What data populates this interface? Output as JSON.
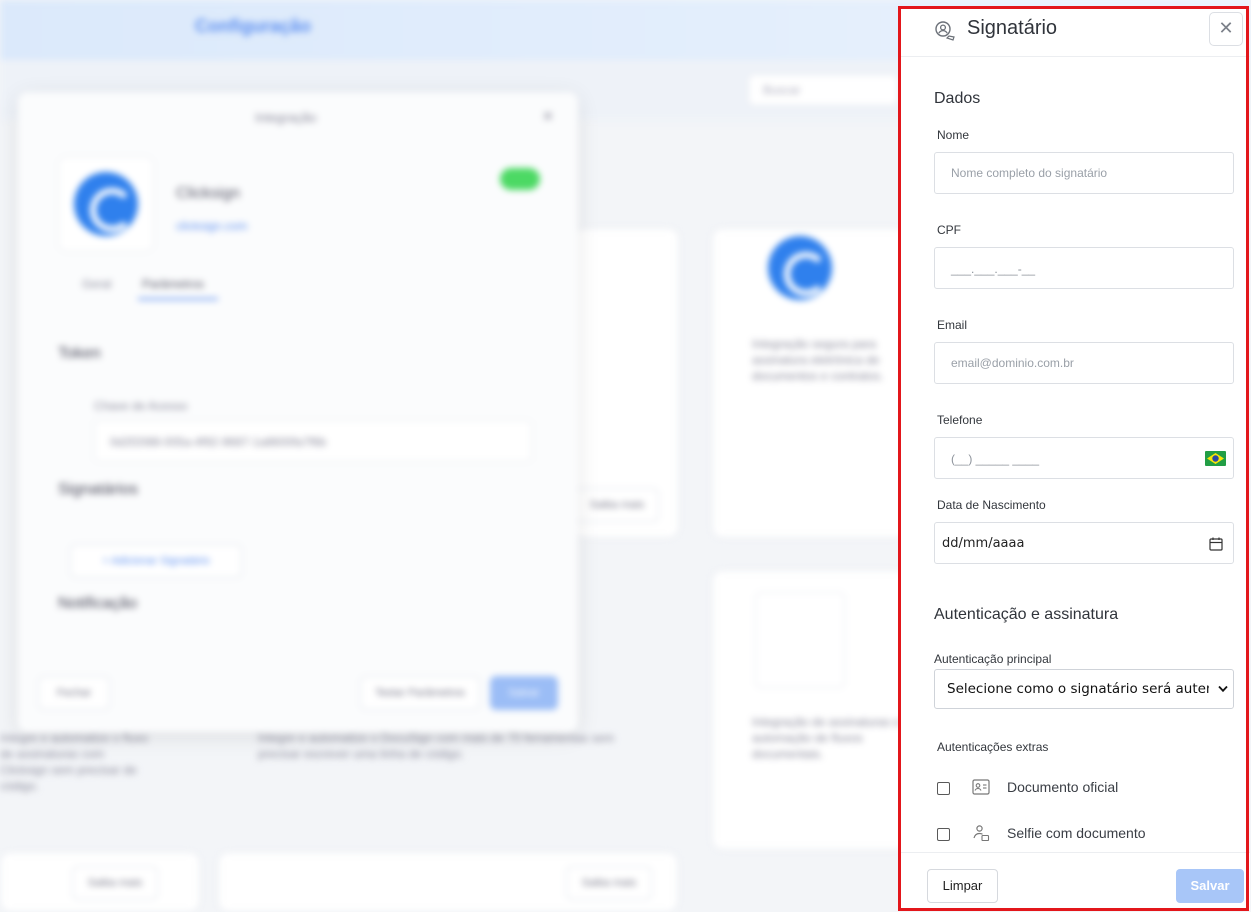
{
  "background": {
    "topbar_title": "Configuração",
    "search_placeholder": "Buscar",
    "modal": {
      "title": "Integração",
      "app_name": "Clicksign",
      "app_link": "clicksign.com",
      "tabs": [
        "Geral",
        "Parâmetros"
      ],
      "token_section": "Token",
      "token_label": "Chave de Acesso",
      "token_value": "0d2f2088-005a-4f92-9687-1a8600fa7f6b",
      "signatarios_section": "Signatários",
      "add_signatario": "+  Adicionar Signatário",
      "notificacao_section": "Notificação",
      "btn_fechar": "Fechar",
      "btn_testar": "Testar Parâmetros",
      "btn_salvar": "Salvar"
    },
    "card_more": "Saiba mais",
    "card_desc_1": "Integre e automatize o fluxo de assinaturas com Clicksign sem precisar de código.",
    "card_desc_2": "Integre e automatize o DocuSign com mais de 70 ferramentas sem precisar escrever uma linha de código."
  },
  "panel": {
    "title": "Signatário",
    "close_label": "✕",
    "section_dados": "Dados",
    "nome": {
      "label": "Nome",
      "placeholder": "Nome completo do signatário",
      "value": ""
    },
    "cpf": {
      "label": "CPF",
      "mask": "___.___.___-__"
    },
    "email": {
      "label": "Email",
      "placeholder": "email@dominio.com.br",
      "value": ""
    },
    "telefone": {
      "label": "Telefone",
      "mask": "(__) _____ ____",
      "flag": "brazil-flag-icon"
    },
    "nascimento": {
      "label": "Data de Nascimento",
      "value": "dd/mm/aaaa",
      "icon": "calendar-icon"
    },
    "section_auth": "Autenticação e assinatura",
    "auth_principal": {
      "label": "Autenticação principal",
      "selected": "Selecione como o signatário será autenticado"
    },
    "auth_extras_label": "Autenticações extras",
    "extras": [
      {
        "label": "Documento oficial",
        "icon": "id-card-icon",
        "checked": false
      },
      {
        "label": "Selfie com documento",
        "icon": "person-document-icon",
        "checked": false
      }
    ],
    "footer": {
      "limpar": "Limpar",
      "salvar": "Salvar"
    },
    "highlight_color": "#e3161b",
    "primary_disabled_color": "#a8c6f8"
  }
}
